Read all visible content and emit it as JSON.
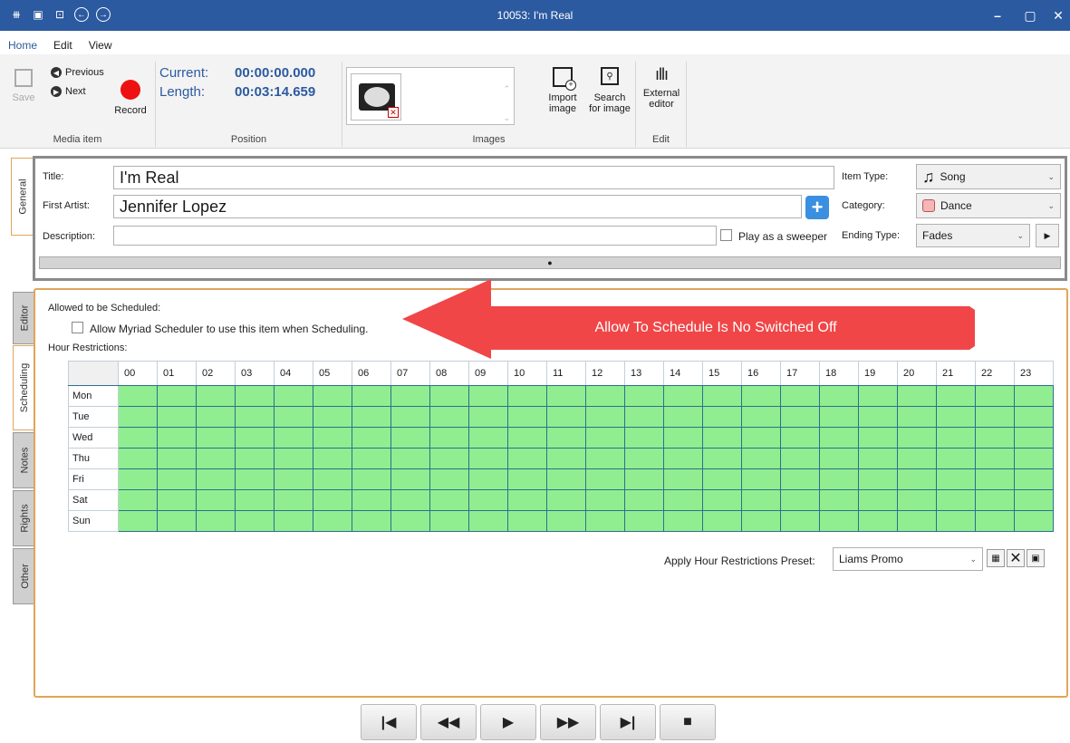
{
  "window": {
    "title": "10053: I'm Real"
  },
  "menu": [
    "Home",
    "Edit",
    "View"
  ],
  "ribbon": {
    "media_item": {
      "save": "Save",
      "previous": "Previous",
      "next": "Next",
      "record": "Record",
      "label": "Media item"
    },
    "position": {
      "current_label": "Current:",
      "current_value": "00:00:00.000",
      "length_label": "Length:",
      "length_value": "00:03:14.659",
      "label": "Position"
    },
    "images": {
      "label": "Images",
      "import": "Import image",
      "search": "Search for image"
    },
    "edit": {
      "external": "External editor",
      "label": "Edit"
    }
  },
  "general": {
    "tab": "General",
    "title_label": "Title:",
    "title_value": "I'm Real",
    "artist_label": "First Artist:",
    "artist_value": "Jennifer Lopez",
    "description_label": "Description:",
    "description_value": "",
    "sweeper_label": "Play as a sweeper",
    "item_type_label": "Item Type:",
    "item_type_value": "Song",
    "category_label": "Category:",
    "category_value": "Dance",
    "category_color": "#f4b6b6",
    "ending_type_label": "Ending Type:",
    "ending_type_value": "Fades"
  },
  "side_tabs": [
    "Editor",
    "Scheduling",
    "Notes",
    "Rights",
    "Other"
  ],
  "scheduling": {
    "allowed_heading": "Allowed to be Scheduled:",
    "allow_checkbox_label": "Allow Myriad Scheduler to use this item when Scheduling.",
    "allow_checked": false,
    "hour_restrictions_label": "Hour Restrictions:",
    "hours": [
      "00",
      "01",
      "02",
      "03",
      "04",
      "05",
      "06",
      "07",
      "08",
      "09",
      "10",
      "11",
      "12",
      "13",
      "14",
      "15",
      "16",
      "17",
      "18",
      "19",
      "20",
      "21",
      "22",
      "23"
    ],
    "days": [
      "Mon",
      "Tue",
      "Wed",
      "Thu",
      "Fri",
      "Sat",
      "Sun"
    ],
    "cell_color": "#90ee90",
    "preset_label": "Apply Hour Restrictions Preset:",
    "preset_value": "Liams Promo"
  },
  "annotation": {
    "text": "Allow To Schedule Is No Switched Off",
    "color": "#f04648"
  }
}
